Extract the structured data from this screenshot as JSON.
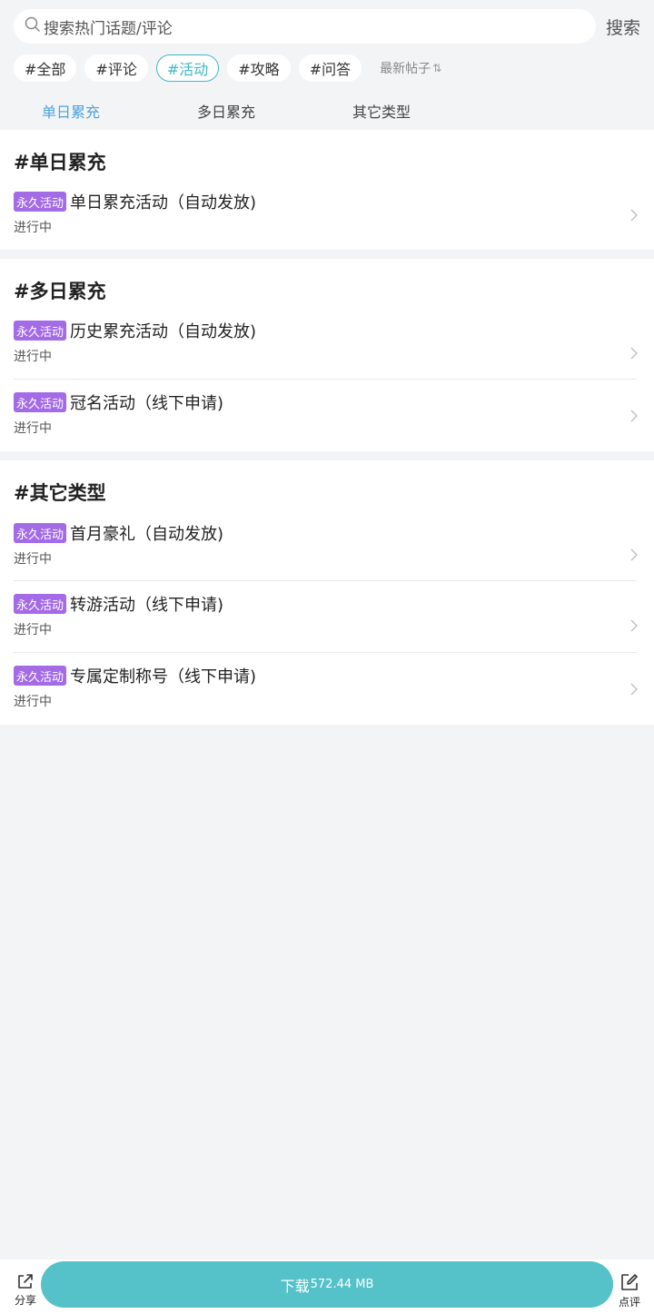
{
  "search": {
    "placeholder": "搜索热门话题/评论",
    "button_label": "搜索"
  },
  "tags": [
    {
      "label": "#全部",
      "active": false
    },
    {
      "label": "#评论",
      "active": false
    },
    {
      "label": "#活动",
      "active": true
    },
    {
      "label": "#攻略",
      "active": false
    },
    {
      "label": "#问答",
      "active": false
    }
  ],
  "sort": {
    "label": "最新帖子",
    "icon": "sort-icon"
  },
  "subtabs": [
    {
      "label": "单日累充",
      "active": true
    },
    {
      "label": "多日累充",
      "active": false
    },
    {
      "label": "其它类型",
      "active": false
    }
  ],
  "sections": [
    {
      "title": "#单日累充",
      "items": [
        {
          "badge": "永久活动",
          "title": "单日累充活动（自动发放)",
          "status": "进行中"
        }
      ]
    },
    {
      "title": "#多日累充",
      "items": [
        {
          "badge": "永久活动",
          "title": "历史累充活动（自动发放)",
          "status": "进行中"
        },
        {
          "badge": "永久活动",
          "title": "冠名活动（线下申请)",
          "status": "进行中"
        }
      ]
    },
    {
      "title": "#其它类型",
      "items": [
        {
          "badge": "永久活动",
          "title": "首月豪礼（自动发放)",
          "status": "进行中"
        },
        {
          "badge": "永久活动",
          "title": "转游活动（线下申请)",
          "status": "进行中"
        },
        {
          "badge": "永久活动",
          "title": "专属定制称号（线下申请)",
          "status": "进行中"
        }
      ]
    }
  ],
  "bottom_bar": {
    "share_label": "分享",
    "download_label": "下载",
    "download_size": "572.44 MB",
    "review_label": "点评"
  },
  "colors": {
    "accent": "#3fb8c4",
    "tab_active": "#4aa3e0",
    "badge": "#a46be6",
    "download_button": "#55c1c9",
    "background": "#f3f4f6"
  }
}
